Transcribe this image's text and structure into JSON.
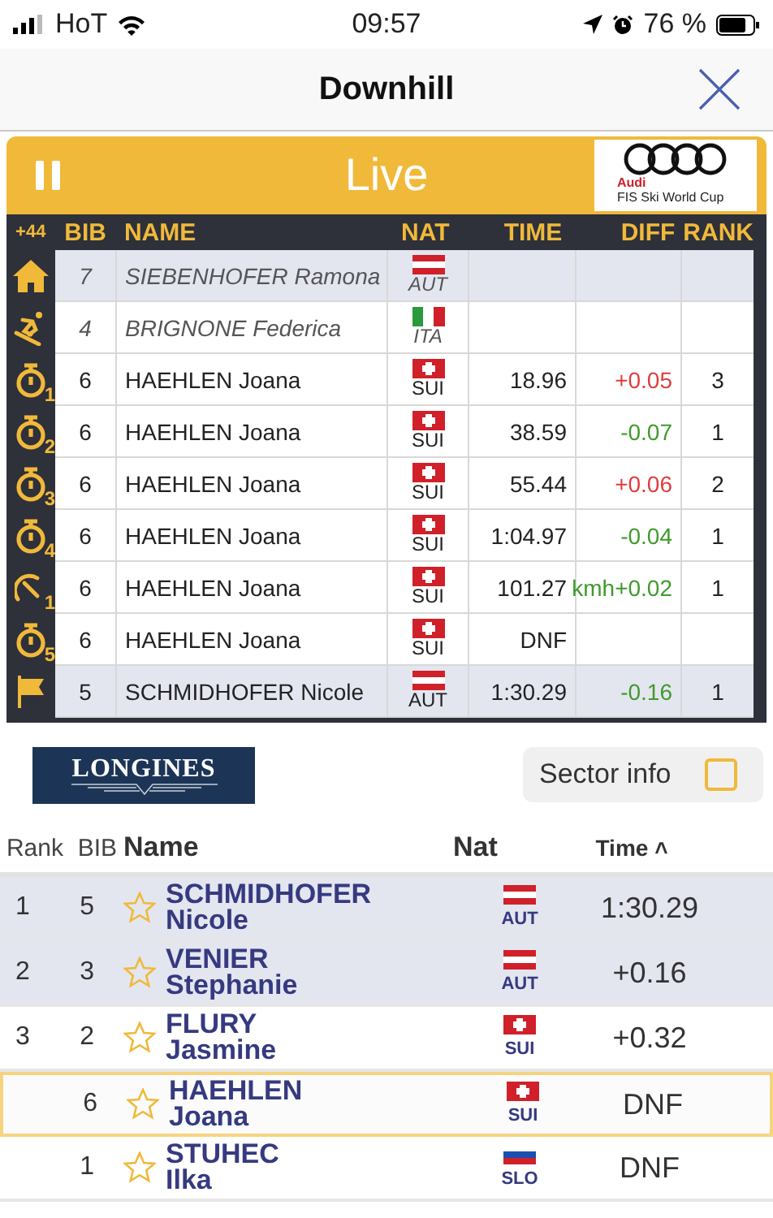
{
  "status_bar": {
    "carrier": "HoT",
    "time": "09:57",
    "battery": "76 %"
  },
  "nav": {
    "title": "Downhill"
  },
  "live_bar": {
    "label": "Live",
    "sponsor_brand": "Audi",
    "sponsor_text": "FIS Ski World Cup"
  },
  "live_table": {
    "columns": [
      "+44",
      "BIB",
      "NAME",
      "NAT",
      "TIME",
      "DIFF",
      "RANK"
    ],
    "rows": [
      {
        "sector": {
          "kind": "home"
        },
        "bib": "7",
        "name": "SIEBENHOFER Ramona",
        "nation": {
          "kind": "aut",
          "code": "AUT"
        },
        "italic": true,
        "highlighted": true
      },
      {
        "sector": {
          "kind": "skier"
        },
        "bib": "4",
        "name": "BRIGNONE Federica",
        "nation": {
          "kind": "ita",
          "code": "ITA"
        },
        "italic": true,
        "highlighted": false
      },
      {
        "sector": {
          "kind": "stopwatch",
          "number": "1"
        },
        "bib": "6",
        "name": "HAEHLEN Joana",
        "nation": {
          "kind": "sui",
          "code": "SUI"
        },
        "time": "18.96",
        "diff": {
          "text": "+0.05",
          "color": "#e03c3c"
        },
        "rank": "3",
        "italic": false,
        "highlighted": false
      },
      {
        "sector": {
          "kind": "stopwatch",
          "number": "2"
        },
        "bib": "6",
        "name": "HAEHLEN Joana",
        "nation": {
          "kind": "sui",
          "code": "SUI"
        },
        "time": "38.59",
        "diff": {
          "text": "-0.07",
          "color": "#3f9a2c"
        },
        "rank": "1",
        "italic": false,
        "highlighted": false
      },
      {
        "sector": {
          "kind": "stopwatch",
          "number": "3"
        },
        "bib": "6",
        "name": "HAEHLEN Joana",
        "nation": {
          "kind": "sui",
          "code": "SUI"
        },
        "time": "55.44",
        "diff": {
          "text": "+0.06",
          "color": "#e03c3c"
        },
        "rank": "2",
        "italic": false,
        "highlighted": false
      },
      {
        "sector": {
          "kind": "stopwatch",
          "number": "4"
        },
        "bib": "6",
        "name": "HAEHLEN Joana",
        "nation": {
          "kind": "sui",
          "code": "SUI"
        },
        "time": "1:04.97",
        "diff": {
          "text": "-0.04",
          "color": "#3f9a2c"
        },
        "rank": "1",
        "italic": false,
        "highlighted": false
      },
      {
        "sector": {
          "kind": "speed",
          "number": "1"
        },
        "bib": "6",
        "name": "HAEHLEN Joana",
        "nation": {
          "kind": "sui",
          "code": "SUI"
        },
        "time": "101.27",
        "diff": {
          "text": "kmh+0.02",
          "color": "#3f9a2c"
        },
        "rank": "1",
        "italic": false,
        "highlighted": false
      },
      {
        "sector": {
          "kind": "stopwatch",
          "number": "5"
        },
        "bib": "6",
        "name": "HAEHLEN Joana",
        "nation": {
          "kind": "sui",
          "code": "SUI"
        },
        "time": "DNF",
        "italic": false,
        "highlighted": false
      },
      {
        "sector": {
          "kind": "finish"
        },
        "bib": "5",
        "name": "SCHMIDHOFER Nicole",
        "nation": {
          "kind": "aut",
          "code": "AUT"
        },
        "time": "1:30.29",
        "diff": {
          "text": "-0.16",
          "color": "#3f9a2c"
        },
        "rank": "1",
        "italic": false,
        "highlighted": true
      }
    ]
  },
  "timing_logo": "LONGINES",
  "sector_info": {
    "label": "Sector info",
    "checked": false
  },
  "results": {
    "columns": [
      "Rank",
      "BIB",
      "Name",
      "Nat",
      "Time"
    ],
    "sort_mark": "˄",
    "rows": [
      {
        "rank": "1",
        "bib": "5",
        "surname": "SCHMIDHOFER",
        "firstname": "Nicole",
        "nation": {
          "kind": "aut",
          "code": "AUT"
        },
        "time": "1:30.29",
        "starred": false,
        "highlighted": true,
        "selected": false
      },
      {
        "rank": "2",
        "bib": "3",
        "surname": "VENIER",
        "firstname": "Stephanie",
        "nation": {
          "kind": "aut",
          "code": "AUT"
        },
        "time": "+0.16",
        "starred": false,
        "highlighted": true,
        "selected": false
      },
      {
        "rank": "3",
        "bib": "2",
        "surname": "FLURY",
        "firstname": "Jasmine",
        "nation": {
          "kind": "sui",
          "code": "SUI"
        },
        "time": "+0.32",
        "starred": false,
        "highlighted": false,
        "selected": false
      },
      {
        "bib": "6",
        "surname": "HAEHLEN",
        "firstname": "Joana",
        "nation": {
          "kind": "sui",
          "code": "SUI"
        },
        "time": "DNF",
        "starred": false,
        "highlighted": false,
        "selected": true
      },
      {
        "bib": "1",
        "surname": "STUHEC",
        "firstname": "Ilka",
        "nation": {
          "kind": "slo",
          "code": "SLO"
        },
        "time": "DNF",
        "starred": false,
        "highlighted": false,
        "selected": false
      }
    ]
  }
}
